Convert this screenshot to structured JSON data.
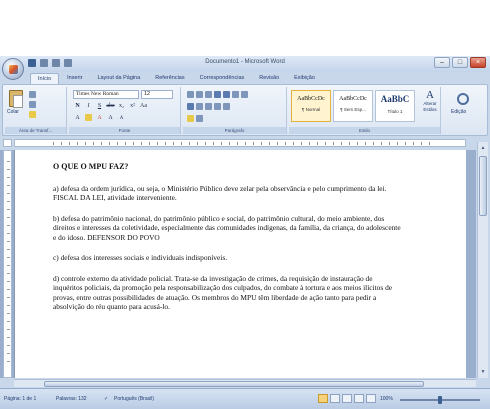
{
  "window": {
    "title": "Documento1 - Microsoft Word"
  },
  "tabs": [
    "Início",
    "Inserir",
    "Layout da Página",
    "Referências",
    "Correspondências",
    "Revisão",
    "Exibição"
  ],
  "ribbon": {
    "clipboard": {
      "paste_label": "Colar",
      "group_label": "Área de Transf..."
    },
    "font": {
      "font_name": "Times New Roman",
      "font_size": "12",
      "group_label": "Fonte"
    },
    "paragraph": {
      "group_label": "Parágrafo"
    },
    "styles": {
      "items": [
        {
          "sample": "AaBbCcDc",
          "name": "¶ Normal"
        },
        {
          "sample": "AaBbCcDc",
          "name": "¶ Sem Esp..."
        },
        {
          "sample": "AaBbC",
          "name": "Título 1"
        }
      ],
      "change_label": "Alterar Estilos",
      "group_label": "Estilo"
    },
    "editing": {
      "label": "Edição"
    }
  },
  "document": {
    "heading": "O QUE O MPU FAZ?",
    "paragraphs": [
      "a) defesa da ordem jurídica, ou seja, o Ministério Público deve zelar pela observância e pelo cumprimento da lei. FISCAL DA LEI, atividade interveniente.",
      "b) defesa do patrimônio nacional, do patrimônio público e social, do patrimônio cultural, do meio ambiente, dos direitos e interesses da coletividade, especialmente das comunidades indígenas, da família, da criança, do adolescente e do idoso. DEFENSOR DO POVO",
      "c) defesa dos interesses sociais e individuais indisponíveis.",
      "d) controle externo da atividade policial. Trata-se da investigação de crimes, da requisição de instauração de inquéritos policiais, da promoção pela responsabilização dos culpados, do combate à tortura e aos meios ilícitos de provas, entre outras possibilidades de atuação. Os membros do MPU têm liberdade de ação tanto para pedir a absolvição do réu quanto para acusá-lo."
    ]
  },
  "statusbar": {
    "page": "Página: 1 de 1",
    "words": "Palavras: 132",
    "language": "Português (Brasil)",
    "zoom": "100%",
    "zoom_level": 0.5
  }
}
